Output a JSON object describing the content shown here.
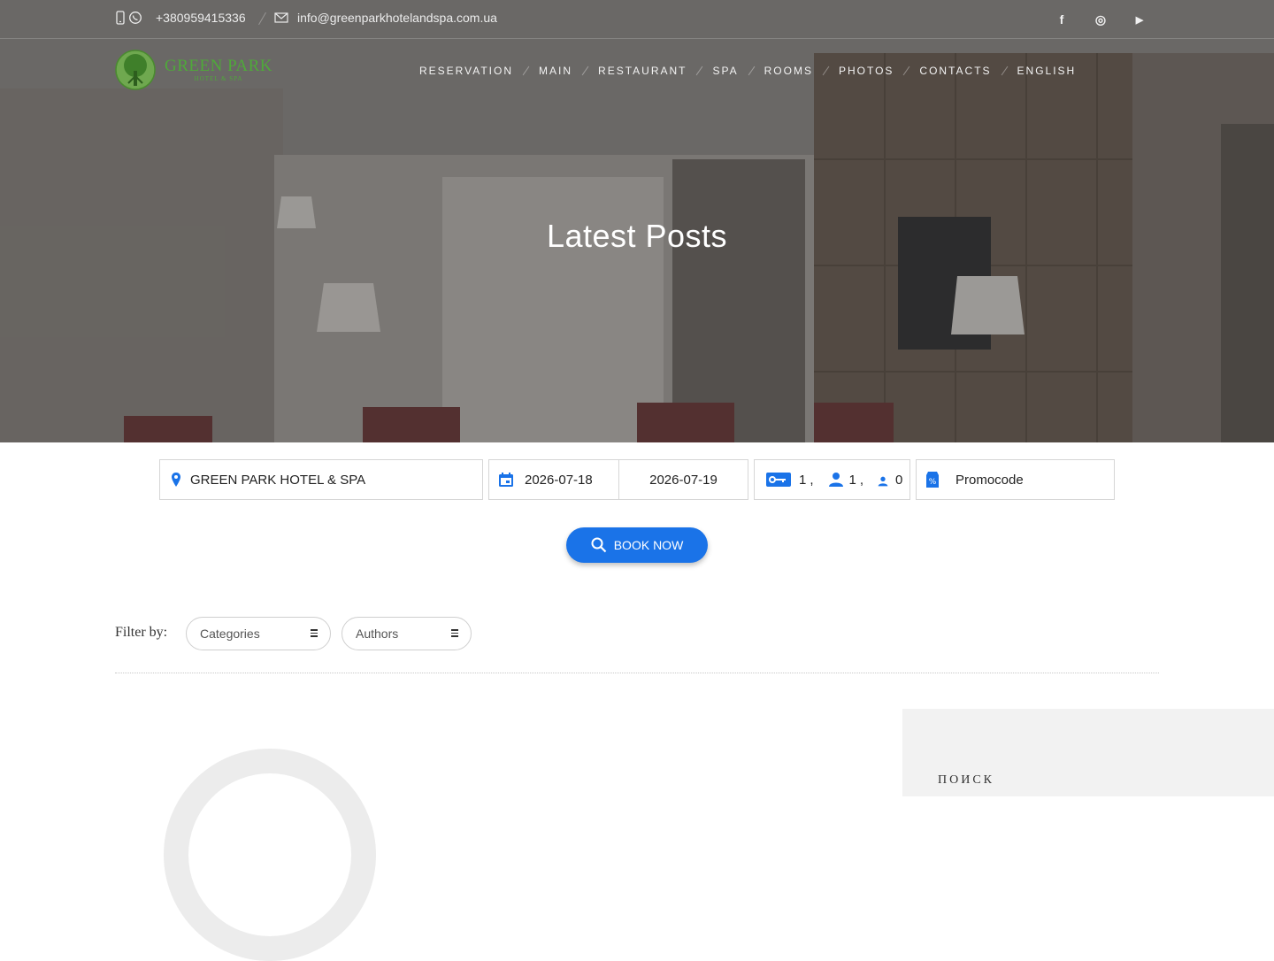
{
  "topbar": {
    "phone": "+380959415336",
    "email": "info@greenparkhotelandspa.com.ua",
    "social": [
      {
        "icon": "facebook-icon",
        "glyph": "f"
      },
      {
        "icon": "instagram-icon",
        "glyph": "◎"
      },
      {
        "icon": "youtube-icon",
        "glyph": "▶"
      }
    ]
  },
  "logo": {
    "title": "GREEN PARK",
    "subtitle": "HOTEL & SPA"
  },
  "nav": {
    "items": [
      "RESERVATION",
      "MAIN",
      "RESTAURANT",
      "SPA",
      "ROOMS",
      "PHOTOS",
      "CONTACTS",
      "ENGLISH"
    ]
  },
  "hero": {
    "title": "Latest Posts"
  },
  "booking": {
    "hotel": "GREEN PARK HOTEL & SPA",
    "checkin": "2026-07-18",
    "checkout": "2026-07-19",
    "rooms": "1",
    "adults": "1",
    "children": "0",
    "promocode_placeholder": "Promocode",
    "book_label": "BOOK NOW",
    "accent": "#1a73e8"
  },
  "filter": {
    "label": "Filter by:",
    "categories": "Categories",
    "authors": "Authors"
  },
  "sidebar": {
    "title": "ПОИСК"
  }
}
